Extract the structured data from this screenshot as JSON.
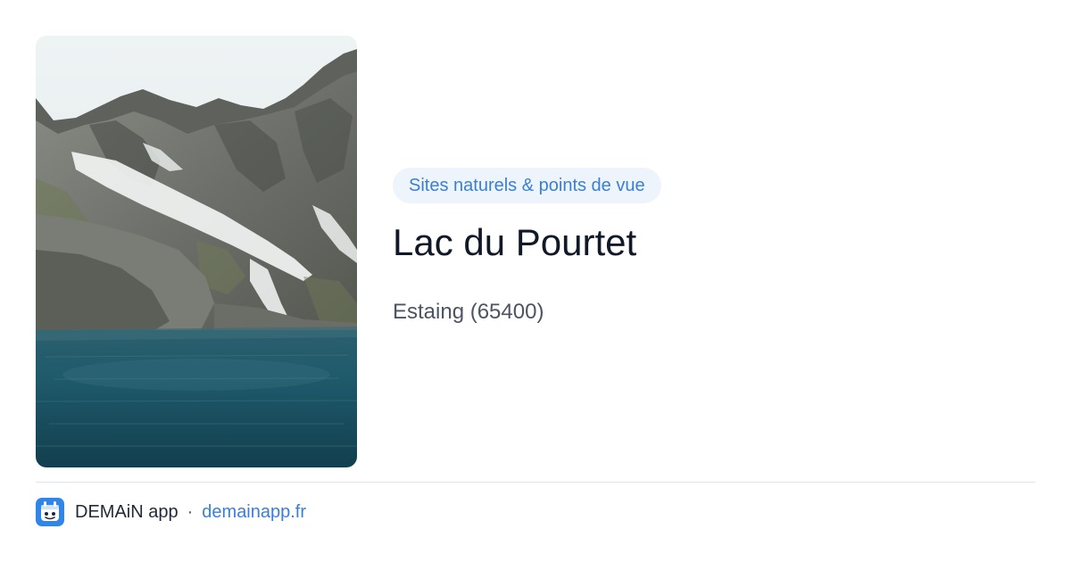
{
  "card": {
    "category": "Sites naturels & points de vue",
    "title": "Lac du Pourtet",
    "location": "Estaing (65400)"
  },
  "footer": {
    "app_name": "DEMAiN app",
    "separator": "·",
    "domain": "demainapp.fr"
  },
  "photo": {
    "subject": "mountain-lake-photo"
  },
  "colors": {
    "accent": "#3a7fd6",
    "pill_background": "#eef4fc",
    "title": "#111827",
    "subtitle": "#4b5563",
    "divider": "#dfe5ea"
  }
}
